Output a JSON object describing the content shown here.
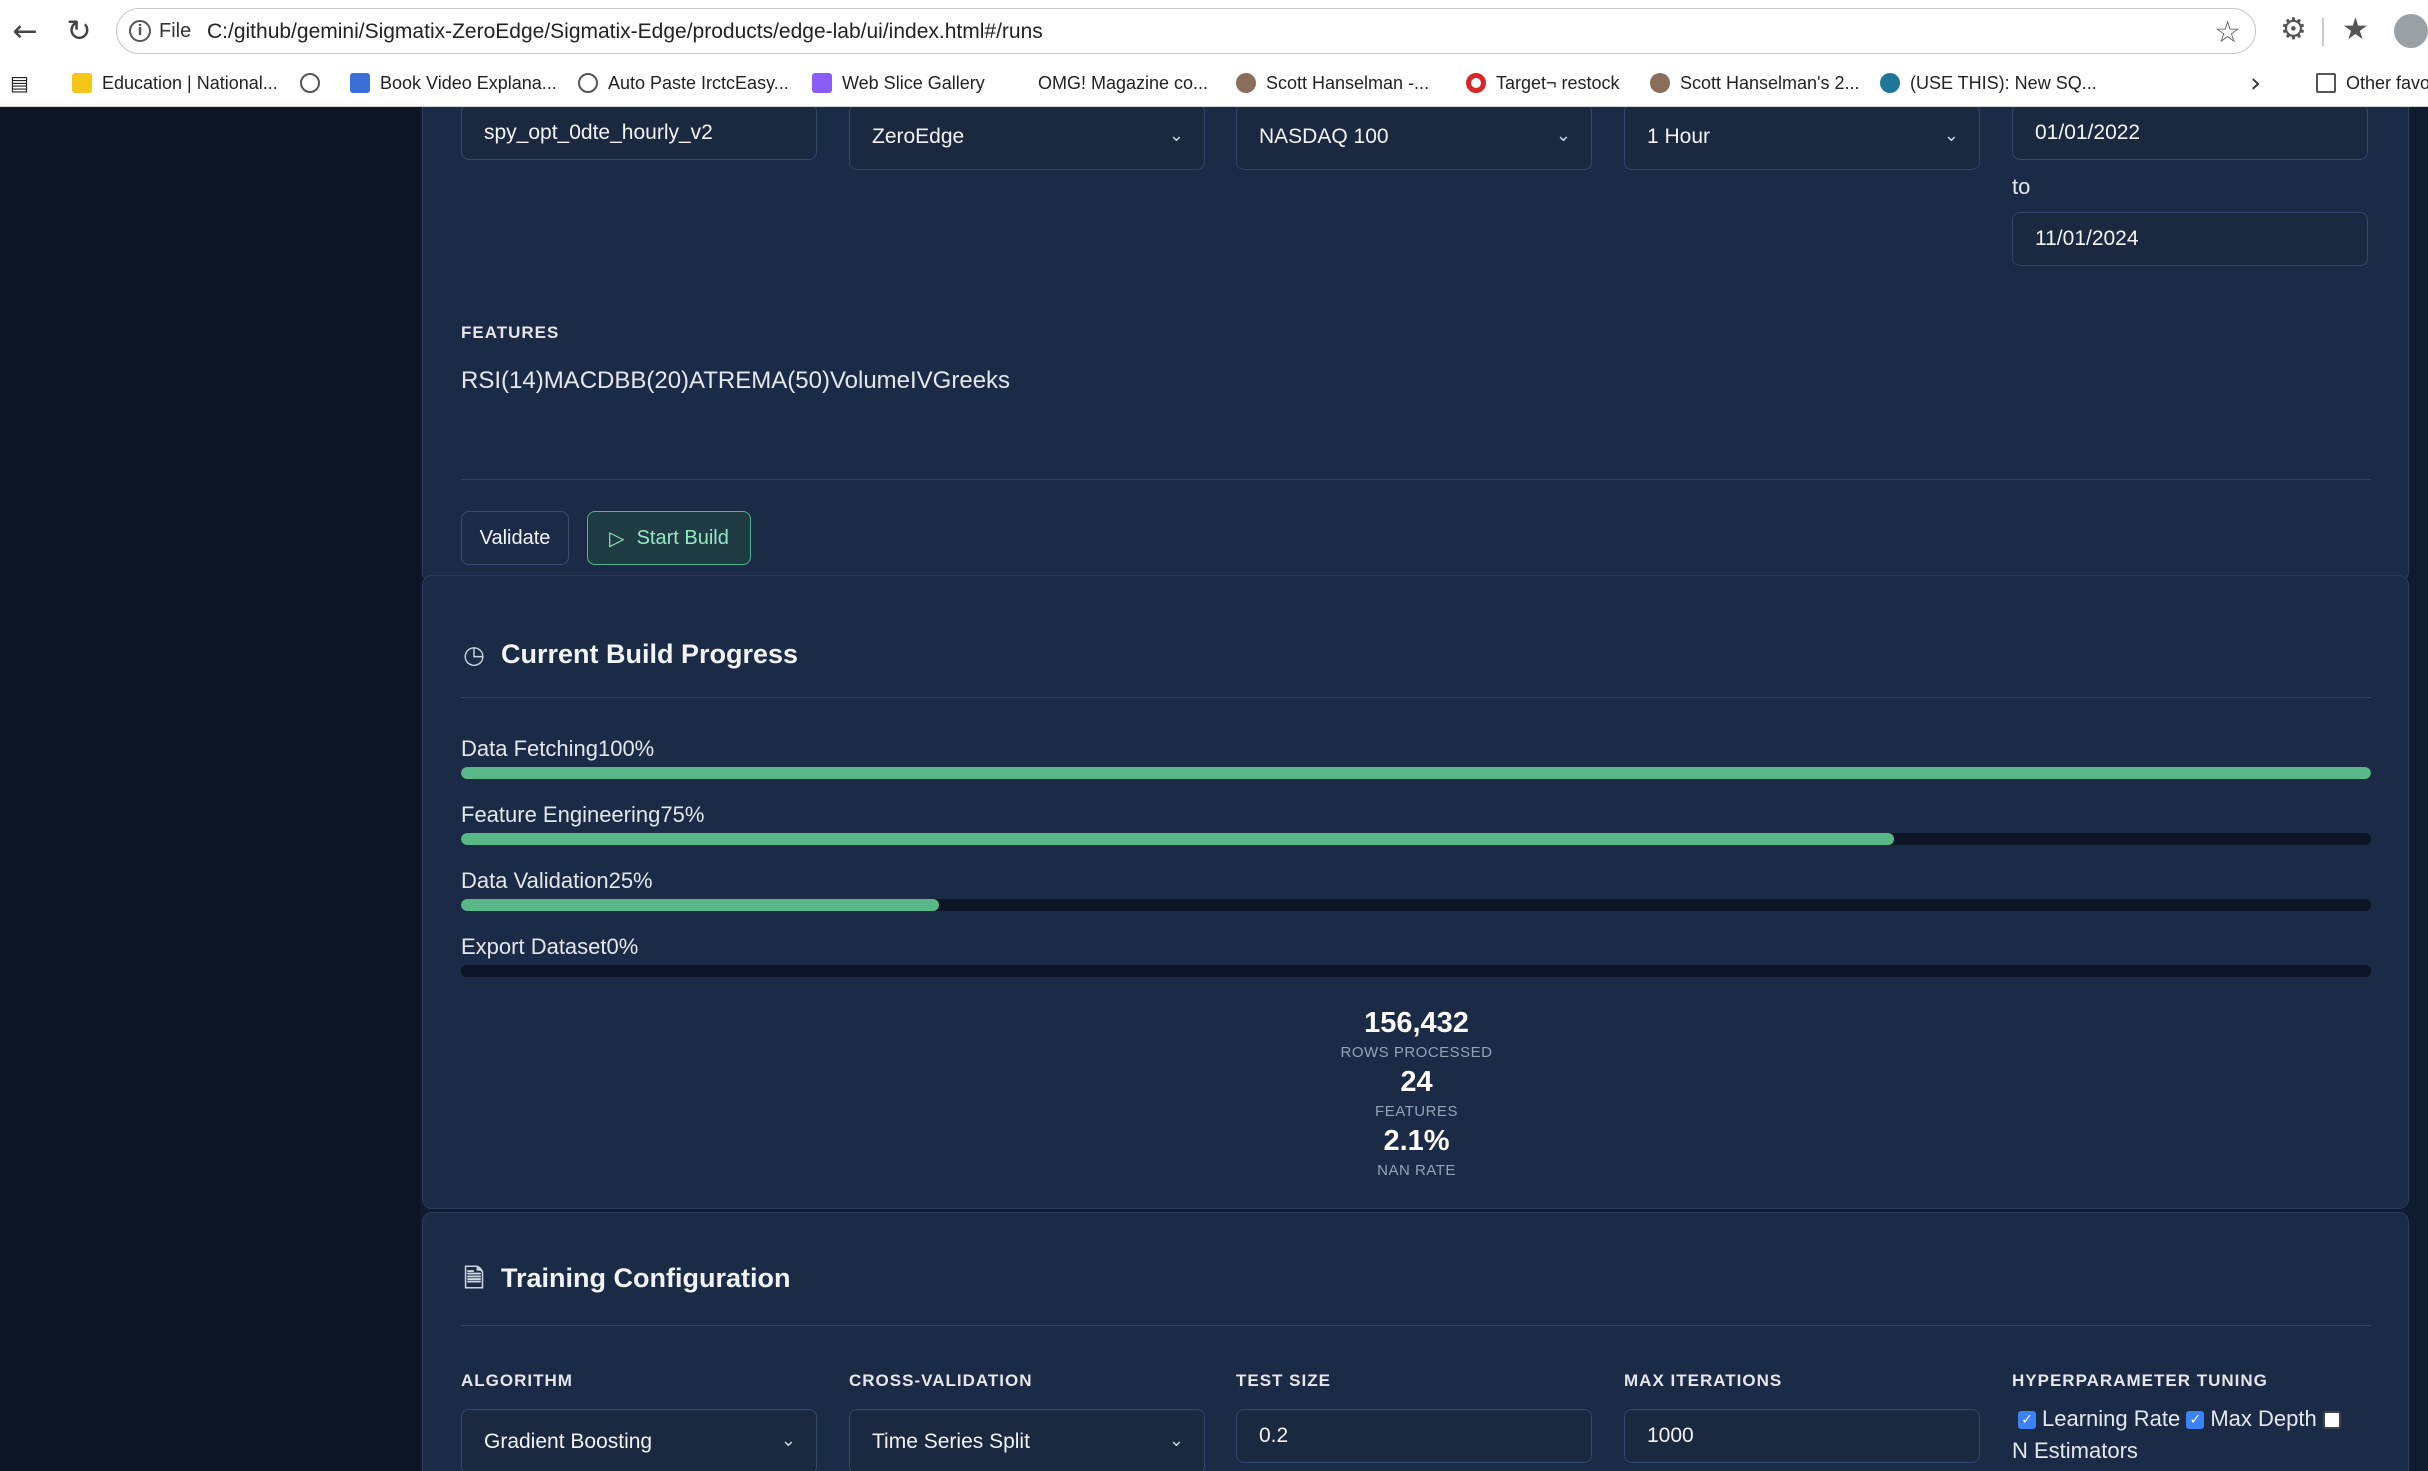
{
  "browser": {
    "addr_file_label": "File",
    "url": "C:/github/gemini/Sigmatix-ZeroEdge/Sigmatix-Edge/products/edge-lab/ui/index.html#/runs",
    "bookmarks": [
      {
        "label": "Education | National...",
        "icon": "bookmark-yellow-icon"
      },
      {
        "label": "",
        "icon": "globe-icon"
      },
      {
        "label": "Book Video Explana...",
        "icon": "sailboat-icon"
      },
      {
        "label": "Auto Paste IrctcEasy...",
        "icon": "globe-icon"
      },
      {
        "label": "Web Slice Gallery",
        "icon": "slice-icon"
      },
      {
        "label": "OMG! Magazine co...",
        "icon": ""
      },
      {
        "label": "Scott Hanselman -...",
        "icon": "person-icon"
      },
      {
        "label": "Target¬ restock",
        "icon": "target-icon"
      },
      {
        "label": "Scott Hanselman's 2...",
        "icon": "person-icon"
      },
      {
        "label": "(USE THIS): New SQ...",
        "icon": "wordpress-icon"
      }
    ],
    "other_favorites": "Other favo"
  },
  "build_config": {
    "dataset_name": "spy_opt_0dte_hourly_v2",
    "provider": "ZeroEdge",
    "universe": "NASDAQ 100",
    "interval": "1 Hour",
    "date_from": "01/01/2022",
    "date_to_label": "to",
    "date_to": "11/01/2024",
    "features_label": "FEATURES",
    "features": "RSI(14)MACDBB(20)ATREMA(50)VolumeIVGreeks",
    "validate_label": "Validate",
    "start_build_label": "Start Build"
  },
  "progress": {
    "title": "Current Build Progress",
    "steps": [
      {
        "label": "Data Fetching",
        "pct_text": "100%",
        "pct": 100
      },
      {
        "label": "Feature Engineering",
        "pct_text": "75%",
        "pct": 75
      },
      {
        "label": "Data Validation",
        "pct_text": "25%",
        "pct": 25
      },
      {
        "label": "Export Dataset",
        "pct_text": "0%",
        "pct": 0
      }
    ],
    "stats": [
      {
        "value": "156,432",
        "label": "ROWS PROCESSED"
      },
      {
        "value": "24",
        "label": "FEATURES"
      },
      {
        "value": "2.1%",
        "label": "NAN RATE"
      }
    ]
  },
  "training": {
    "title": "Training Configuration",
    "algorithm_label": "ALGORITHM",
    "algorithm": "Gradient Boosting",
    "cv_label": "CROSS-VALIDATION",
    "cv": "Time Series Split",
    "test_size_label": "TEST SIZE",
    "test_size": "0.2",
    "max_iter_label": "MAX ITERATIONS",
    "max_iter": "1000",
    "hp_label": "HYPERPARAMETER TUNING",
    "hp_options": [
      {
        "label": "Learning Rate",
        "checked": true
      },
      {
        "label": "Max Depth",
        "checked": true
      },
      {
        "label": "N Estimators",
        "checked": false
      }
    ]
  },
  "colors": {
    "progress_fill": "#58b887",
    "card_bg": "#1b2a45",
    "page_bg": "#0f1b2e",
    "accent_green": "#4fb58f"
  }
}
